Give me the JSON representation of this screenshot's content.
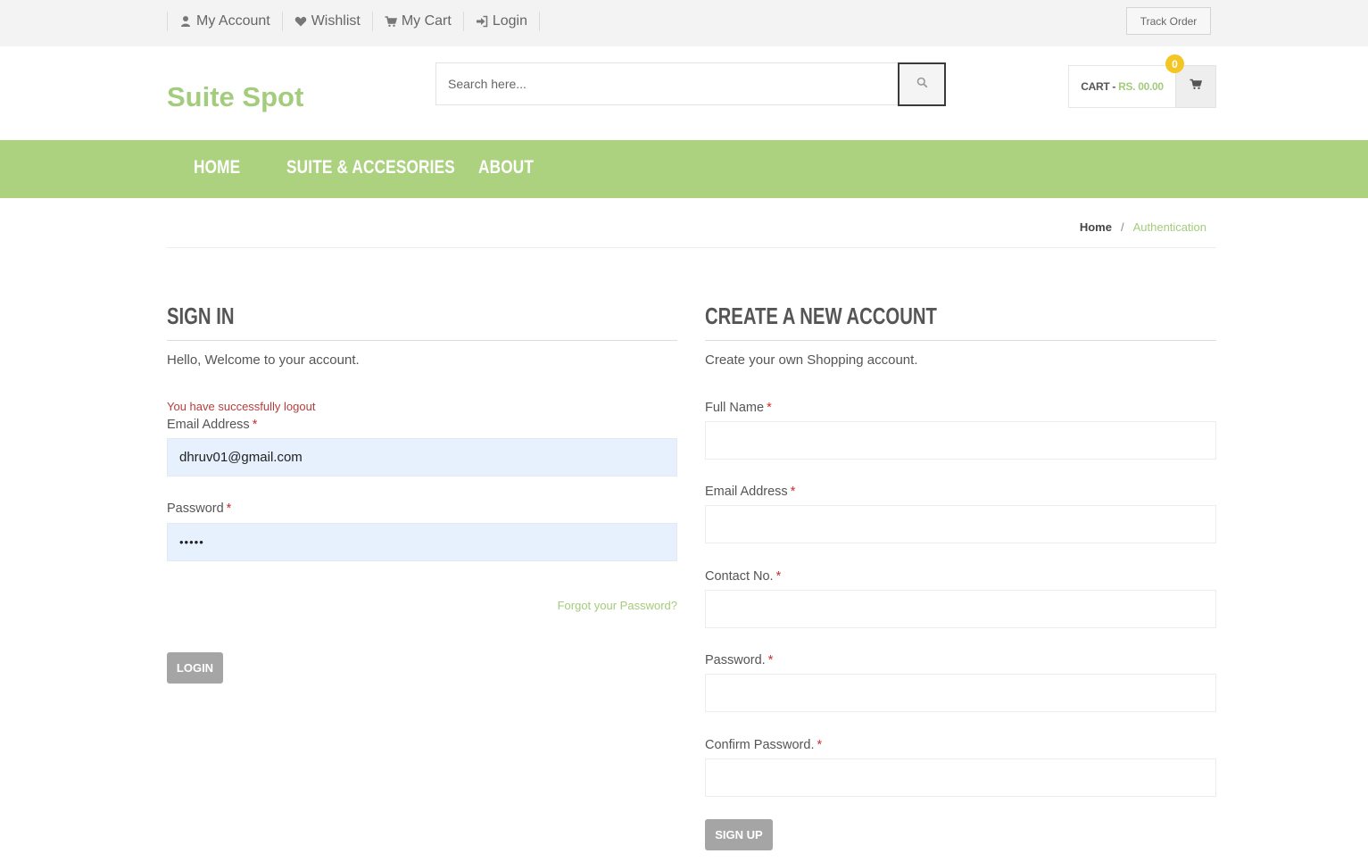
{
  "topbar": {
    "links": [
      {
        "label": "My Account",
        "icon": "user-icon"
      },
      {
        "label": "Wishlist",
        "icon": "heart-icon"
      },
      {
        "label": "My Cart",
        "icon": "cart-icon"
      },
      {
        "label": "Login",
        "icon": "sign-in-icon"
      }
    ],
    "track_order": "Track Order"
  },
  "header": {
    "logo": "Suite Spot",
    "search_placeholder": "Search here...",
    "cart_label": "CART",
    "cart_dash": "-",
    "cart_amount": "RS. 00.00",
    "cart_count": "0"
  },
  "nav": {
    "items": [
      "HOME",
      "SUITE & ACCESORIES",
      "ABOUT"
    ]
  },
  "breadcrumb": {
    "home": "Home",
    "separator": "/",
    "current": "Authentication"
  },
  "signin": {
    "title": "SIGN IN",
    "desc": "Hello, Welcome to your account.",
    "success_msg": "You have successfully logout",
    "email_label": "Email Address",
    "email_value": "dhruv01@gmail.com",
    "password_label": "Password",
    "password_value": "•••••",
    "forgot": "Forgot your Password?",
    "login_btn": "LOGIN"
  },
  "signup": {
    "title": "CREATE A NEW ACCOUNT",
    "desc": "Create your own Shopping account.",
    "fields": [
      "Full Name",
      "Email Address",
      "Contact No.",
      "Password.",
      "Confirm Password."
    ],
    "required_mark": "*",
    "signup_btn": "SIGN UP"
  },
  "colors": {
    "accent_green": "#acd27f",
    "logo_green": "#a3cc7d",
    "badge_yellow": "#f3c623",
    "error_red": "#b83c3c"
  }
}
